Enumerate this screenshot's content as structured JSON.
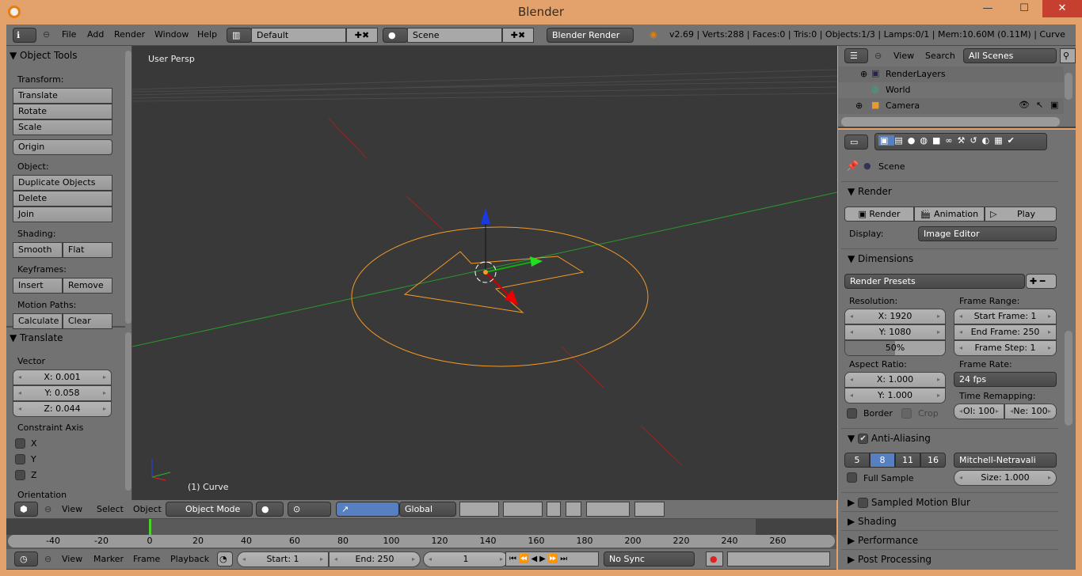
{
  "window": {
    "title": "Blender",
    "minimize": "—",
    "maximize": "☐",
    "close": "✕"
  },
  "info_header": {
    "menus": [
      "File",
      "Add",
      "Render",
      "Window",
      "Help"
    ],
    "layout": "Default",
    "scene": "Scene",
    "engine": "Blender Render",
    "stats": "v2.69 | Verts:288 | Faces:0 | Tris:0 | Objects:1/3 | Lamps:0/1 | Mem:10.60M (0.11M) | Curve"
  },
  "toolshelf": {
    "title": "Object Tools",
    "transform_label": "Transform:",
    "transform": [
      "Translate",
      "Rotate",
      "Scale"
    ],
    "origin": "Origin",
    "object_label": "Object:",
    "object": [
      "Duplicate Objects",
      "Delete",
      "Join"
    ],
    "shading_label": "Shading:",
    "smooth": "Smooth",
    "flat": "Flat",
    "keyframes_label": "Keyframes:",
    "insert": "Insert",
    "remove": "Remove",
    "motion_label": "Motion Paths:",
    "calculate": "Calculate",
    "clear": "Clear"
  },
  "operator": {
    "title": "Translate",
    "vector_label": "Vector",
    "x": "X: 0.001",
    "y": "Y: 0.058",
    "z": "Z: 0.044",
    "constraint_label": "Constraint Axis",
    "axes": [
      "X",
      "Y",
      "Z"
    ],
    "orientation_label": "Orientation"
  },
  "viewport": {
    "view_name": "User Persp",
    "object_label": "(1) Curve",
    "colors": {
      "bg": "#393939",
      "selected": "#f39a28",
      "x_axis": "#c22",
      "y_axis": "#2c2"
    }
  },
  "view3d_header": {
    "menus": [
      "View",
      "Select",
      "Object"
    ],
    "mode": "Object Mode",
    "orientation": "Global"
  },
  "timeline": {
    "ticks": [
      "-40",
      "-20",
      "0",
      "20",
      "40",
      "60",
      "80",
      "100",
      "120",
      "140",
      "160",
      "180",
      "200",
      "220",
      "240",
      "260"
    ],
    "current_frame": 0
  },
  "timeline_header": {
    "menus": [
      "View",
      "Marker",
      "Frame",
      "Playback"
    ],
    "start": "Start: 1",
    "end": "End: 250",
    "frame": "1",
    "sync": "No Sync"
  },
  "outliner": {
    "view": "View",
    "search": "Search",
    "filter": "All Scenes",
    "items": [
      "RenderLayers",
      "World",
      "Camera"
    ]
  },
  "properties": {
    "context": "Scene",
    "render_title": "Render",
    "render_btn": "Render",
    "animation_btn": "Animation",
    "play_btn": "Play",
    "display_label": "Display:",
    "display_value": "Image Editor",
    "dimensions_title": "Dimensions",
    "presets": "Render Presets",
    "resolution_label": "Resolution:",
    "res_x": "X: 1920",
    "res_y": "Y: 1080",
    "res_pct": "50%",
    "res_pct_value": 50,
    "frame_range_label": "Frame Range:",
    "start_frame": "Start Frame: 1",
    "end_frame": "End Frame: 250",
    "frame_step": "Frame Step: 1",
    "aspect_label": "Aspect Ratio:",
    "asp_x": "X: 1.000",
    "asp_y": "Y: 1.000",
    "frame_rate_label": "Frame Rate:",
    "frame_rate": "24 fps",
    "time_remap_label": "Time Remapping:",
    "old": "Ol: 100",
    "new": "Ne: 100",
    "border": "Border",
    "crop": "Crop",
    "aa_title": "Anti-Aliasing",
    "aa_samples": [
      "5",
      "8",
      "11",
      "16"
    ],
    "aa_selected": "8",
    "aa_filter": "Mitchell-Netravali",
    "full_sample": "Full Sample",
    "size": "Size: 1.000",
    "sections": [
      "Sampled Motion Blur",
      "Shading",
      "Performance",
      "Post Processing"
    ],
    "accent": "#5680c2"
  }
}
